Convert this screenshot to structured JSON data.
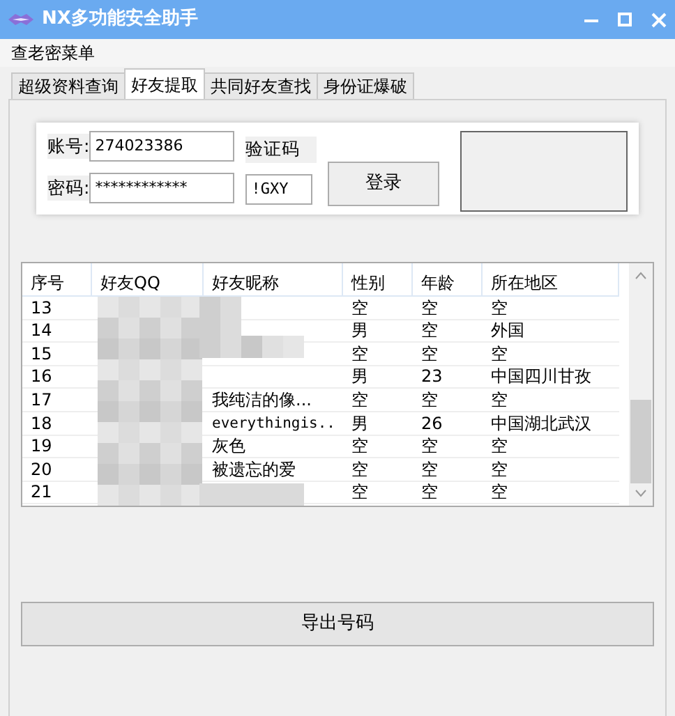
{
  "window": {
    "title": "NX多功能安全助手"
  },
  "menu": [
    "查老密菜单"
  ],
  "tabs": [
    {
      "label": "超级资料查询",
      "selected": false
    },
    {
      "label": "好友提取",
      "selected": true
    },
    {
      "label": "共同好友查找",
      "selected": false
    },
    {
      "label": "身份证爆破",
      "selected": false
    }
  ],
  "login": {
    "account_label": "账号:",
    "account": "274023386",
    "password_label": "密码:",
    "password": "************",
    "captcha_label": "验证码",
    "captcha": "!GXY",
    "login_button": "登录"
  },
  "table": {
    "columns": [
      "序号",
      "好友QQ",
      "好友昵称",
      "性别",
      "年龄",
      "所在地区"
    ],
    "rows": [
      [
        "13",
        "",
        "",
        "空",
        "空",
        "空"
      ],
      [
        "14",
        "",
        "",
        "男",
        "空",
        "外国"
      ],
      [
        "15",
        "",
        "",
        "空",
        "空",
        "空"
      ],
      [
        "16",
        "",
        "",
        "男",
        "23",
        "中国四川甘孜"
      ],
      [
        "17",
        "",
        "我纯洁的像...",
        "空",
        "空",
        "空"
      ],
      [
        "18",
        "",
        "everythingis..",
        "男",
        "26",
        "中国湖北武汉"
      ],
      [
        "19",
        "",
        "灰色",
        "空",
        "空",
        "空"
      ],
      [
        "20",
        "",
        "被遗忘的爱",
        "空",
        "空",
        "空"
      ],
      [
        "21",
        "",
        "",
        "空",
        "空",
        "空"
      ]
    ]
  },
  "export_button": "导出号码"
}
